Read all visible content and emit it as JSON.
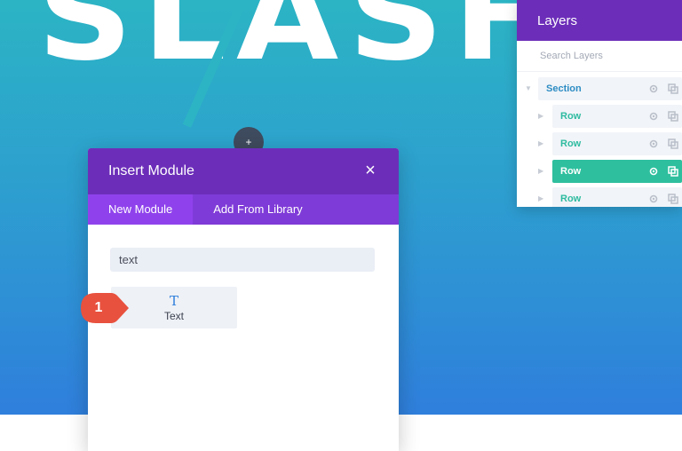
{
  "hero": {
    "headline": "SLASH"
  },
  "insert_module": {
    "title": "Insert Module",
    "close_label": "×",
    "tabs": [
      {
        "label": "New Module",
        "active": true
      },
      {
        "label": "Add From Library",
        "active": false
      }
    ],
    "search_value": "text",
    "results": [
      {
        "icon": "text-module-icon",
        "icon_glyph": "T",
        "label": "Text"
      }
    ]
  },
  "annotation": {
    "step": "1"
  },
  "layers": {
    "title": "Layers",
    "search_placeholder": "Search Layers",
    "items": [
      {
        "label": "Section",
        "type": "section",
        "active": false
      },
      {
        "label": "Row",
        "type": "row",
        "active": false
      },
      {
        "label": "Row",
        "type": "row",
        "active": false
      },
      {
        "label": "Row",
        "type": "row",
        "active": true
      },
      {
        "label": "Row",
        "type": "row",
        "active": false
      }
    ]
  },
  "colors": {
    "purple_dark": "#6c2eb9",
    "purple_tab": "#7f3bd8",
    "purple_active": "#8f42ec",
    "teal": "#2ebf9e",
    "badge_red": "#e8513e",
    "gradient_top": "#2cb4c4",
    "gradient_bottom": "#2f7fdc"
  }
}
